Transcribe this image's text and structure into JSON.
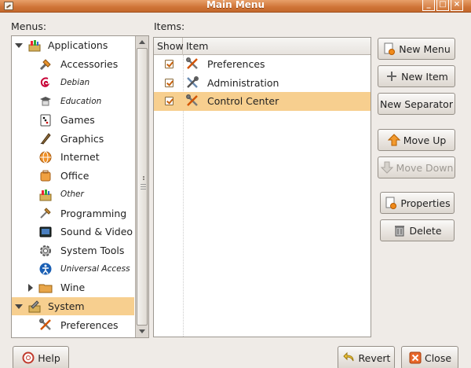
{
  "window": {
    "title": "Main Menu",
    "controls": [
      "_",
      "□",
      "×"
    ]
  },
  "labels": {
    "menus": "Menus:",
    "items": "Items:"
  },
  "menus_tree": [
    {
      "label": "Applications",
      "icon": "applications-icon",
      "level": 0,
      "expanded": true
    },
    {
      "label": "Accessories",
      "icon": "accessories-icon",
      "level": 1
    },
    {
      "label": "Debian",
      "icon": "debian-icon",
      "level": 1,
      "small": true
    },
    {
      "label": "Education",
      "icon": "education-icon",
      "level": 1,
      "small": true
    },
    {
      "label": "Games",
      "icon": "games-icon",
      "level": 1
    },
    {
      "label": "Graphics",
      "icon": "graphics-icon",
      "level": 1
    },
    {
      "label": "Internet",
      "icon": "internet-icon",
      "level": 1
    },
    {
      "label": "Office",
      "icon": "office-icon",
      "level": 1
    },
    {
      "label": "Other",
      "icon": "other-icon",
      "level": 1,
      "small": true
    },
    {
      "label": "Programming",
      "icon": "programming-icon",
      "level": 1
    },
    {
      "label": "Sound & Video",
      "icon": "sound-video-icon",
      "level": 1
    },
    {
      "label": "System Tools",
      "icon": "system-tools-icon",
      "level": 1
    },
    {
      "label": "Universal Access",
      "icon": "universal-access-icon",
      "level": 1,
      "small": true
    },
    {
      "label": "Wine",
      "icon": "wine-folder-icon",
      "level": 1,
      "collapsed": true
    },
    {
      "label": "System",
      "icon": "system-icon",
      "level": 0,
      "expanded": true,
      "selected": true
    },
    {
      "label": "Preferences",
      "icon": "preferences-icon",
      "level": 1
    }
  ],
  "items_table": {
    "columns": [
      "Show",
      "Item"
    ],
    "rows": [
      {
        "show": true,
        "icon": "preferences-icon",
        "label": "Preferences"
      },
      {
        "show": true,
        "icon": "administration-icon",
        "label": "Administration"
      },
      {
        "show": true,
        "icon": "control-center-icon",
        "label": "Control Center",
        "selected": true
      }
    ]
  },
  "buttons": {
    "new_menu": "New Menu",
    "new_item": "New Item",
    "new_separator": "New Separator",
    "move_up": "Move Up",
    "move_down": "Move Down",
    "properties": "Properties",
    "delete": "Delete",
    "help": "Help",
    "revert": "Revert",
    "close": "Close"
  },
  "colors": {
    "titlebar": "#cf7437",
    "selection": "#f7cf8f",
    "window_bg": "#efebe7"
  }
}
